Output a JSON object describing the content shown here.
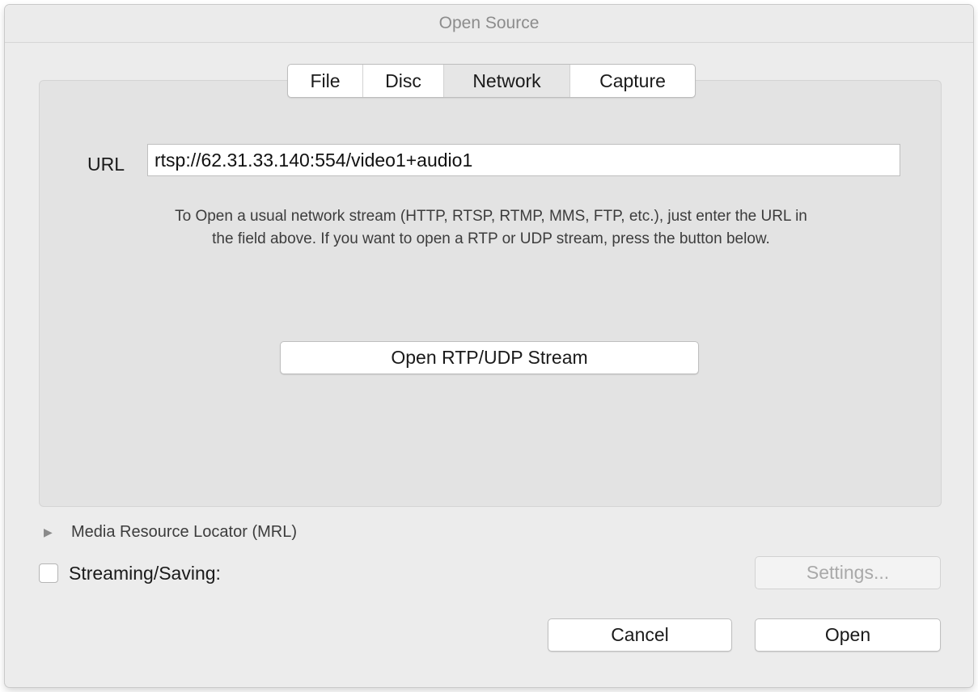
{
  "window": {
    "title": "Open Source"
  },
  "tabs": [
    {
      "label": "File",
      "active": false
    },
    {
      "label": "Disc",
      "active": false
    },
    {
      "label": "Network",
      "active": true
    },
    {
      "label": "Capture",
      "active": false
    }
  ],
  "network": {
    "url_label": "URL",
    "url_value": "rtsp://62.31.33.140:554/video1+audio1",
    "help_line1": "To Open a usual network stream (HTTP, RTSP, RTMP, MMS, FTP, etc.), just enter the URL in",
    "help_line2": "the field above. If you want to open a RTP or UDP stream, press the button below.",
    "rtp_button": "Open RTP/UDP Stream"
  },
  "mrl": {
    "label": "Media Resource Locator (MRL)",
    "icon": "disclosure-triangle-right-icon"
  },
  "streaming": {
    "label": "Streaming/Saving:",
    "checked": false,
    "settings_button": "Settings..."
  },
  "footer": {
    "cancel": "Cancel",
    "open": "Open"
  }
}
